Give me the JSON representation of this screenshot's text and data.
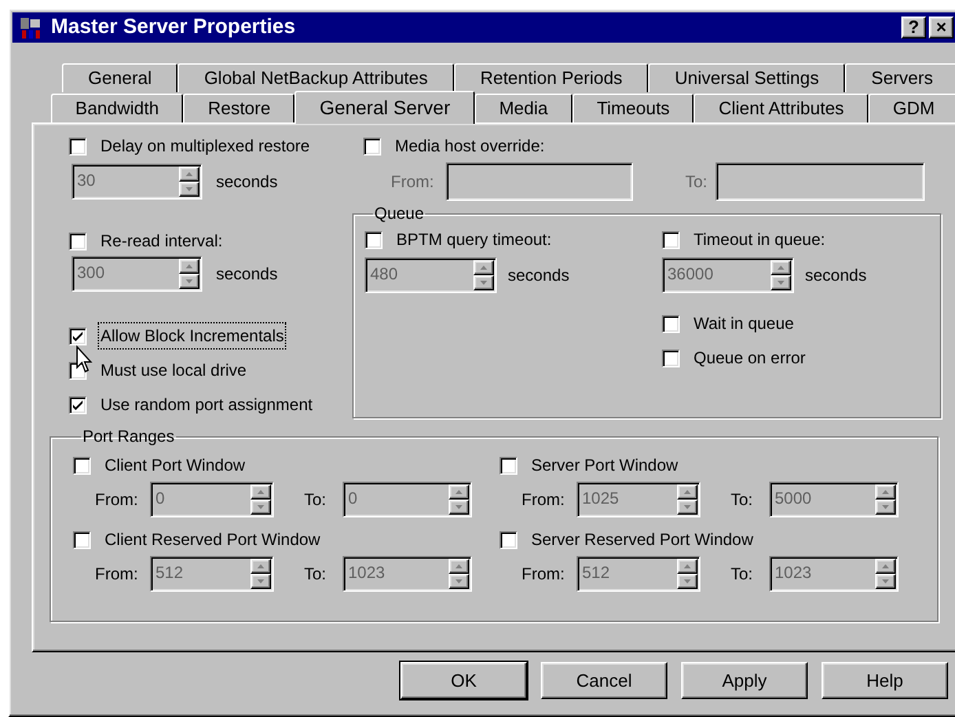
{
  "window": {
    "title": "Master Server Properties",
    "title_buttons": [
      "?",
      "×"
    ]
  },
  "tab_rows": [
    [
      {
        "label": "General",
        "selected": false
      },
      {
        "label": "Global NetBackup Attributes",
        "selected": false
      },
      {
        "label": "Retention Periods",
        "selected": false
      },
      {
        "label": "Universal Settings",
        "selected": false
      },
      {
        "label": "Servers",
        "selected": false
      }
    ],
    [
      {
        "label": "Bandwidth",
        "selected": false
      },
      {
        "label": "Restore",
        "selected": false
      },
      {
        "label": "General Server",
        "selected": true
      },
      {
        "label": "Media",
        "selected": false
      },
      {
        "label": "Timeouts",
        "selected": false
      },
      {
        "label": "Client Attributes",
        "selected": false
      },
      {
        "label": "GDM",
        "selected": false
      }
    ]
  ],
  "delay": {
    "label": "Delay on multiplexed restore",
    "checked": false,
    "value": "30",
    "unit": "seconds"
  },
  "reread": {
    "label": "Re-read interval:",
    "checked": false,
    "value": "300",
    "unit": "seconds"
  },
  "options": [
    {
      "label": "Allow Block Incrementals",
      "checked": true,
      "focused": true
    },
    {
      "label": "Must use local drive",
      "checked": false,
      "focused": false
    },
    {
      "label": "Use random port assignment",
      "checked": true,
      "focused": false
    }
  ],
  "media_host_override": {
    "label": "Media host override:",
    "checked": false,
    "from_label": "From:",
    "to_label": "To:"
  },
  "queue": {
    "title": "Queue",
    "bptm": {
      "label": "BPTM query timeout:",
      "checked": false,
      "value": "480",
      "unit": "seconds"
    },
    "timeout": {
      "label": "Timeout in queue:",
      "checked": false,
      "value": "36000",
      "unit": "seconds"
    },
    "options": [
      {
        "label": "Wait in queue",
        "checked": false
      },
      {
        "label": "Queue on error",
        "checked": false
      }
    ]
  },
  "port_ranges": {
    "title": "Port Ranges",
    "windows": [
      {
        "label": "Client Port Window",
        "checked": false,
        "from_label": "From:",
        "from": "0",
        "to_label": "To:",
        "to": "0"
      },
      {
        "label": "Server Port Window",
        "checked": false,
        "from_label": "From:",
        "from": "1025",
        "to_label": "To:",
        "to": "5000"
      },
      {
        "label": "Client Reserved Port Window",
        "checked": false,
        "from_label": "From:",
        "from": "512",
        "to_label": "To:",
        "to": "1023"
      },
      {
        "label": "Server Reserved Port Window",
        "checked": false,
        "from_label": "From:",
        "from": "512",
        "to_label": "To:",
        "to": "1023"
      }
    ]
  },
  "buttons": [
    {
      "label": "OK",
      "default": true
    },
    {
      "label": "Cancel",
      "default": false
    },
    {
      "label": "Apply",
      "default": false
    },
    {
      "label": "Help",
      "default": false
    }
  ]
}
